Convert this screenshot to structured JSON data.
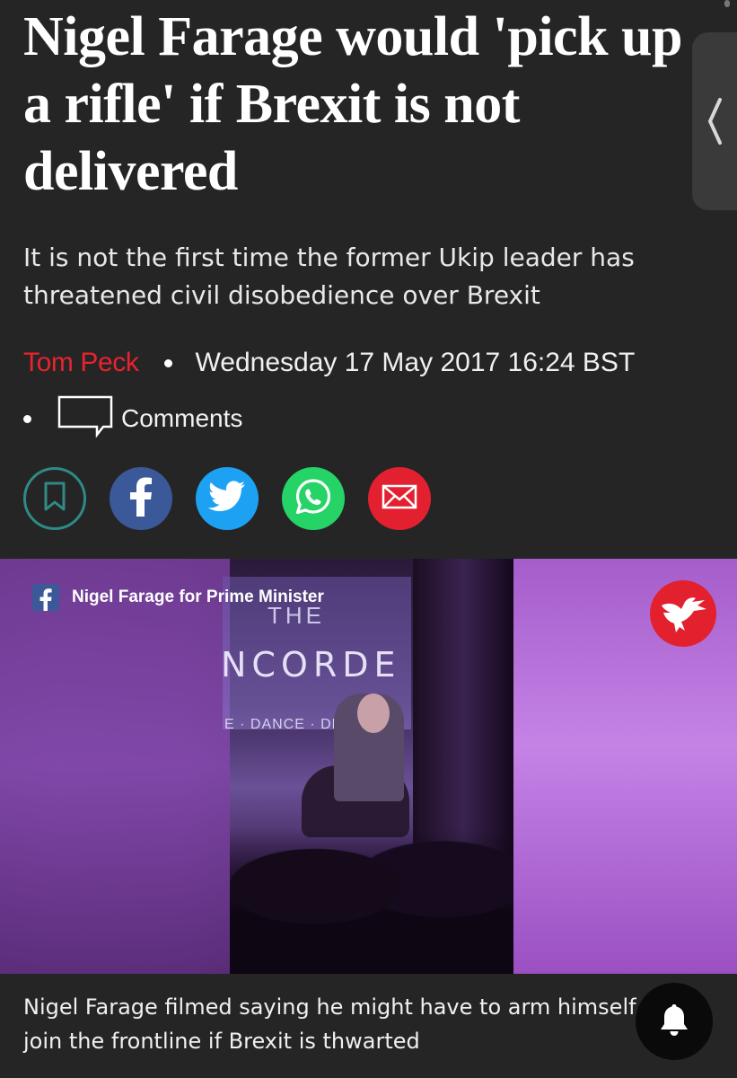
{
  "article": {
    "headline": "Nigel Farage would 'pick up a rifle' if Brexit is not delivered",
    "standfirst": "It is not the first time the former Ukip leader has threatened civil disobedience over Brexit",
    "author": "Tom Peck",
    "date": "Wednesday 17 May 2017 16:24 BST",
    "comments_label": "Comments"
  },
  "share_buttons": [
    {
      "name": "bookmark",
      "icon": "bookmark-icon",
      "color": "#2f8a86"
    },
    {
      "name": "facebook",
      "icon": "facebook-icon",
      "color": "#3b5998"
    },
    {
      "name": "twitter",
      "icon": "twitter-icon",
      "color": "#1da1f2"
    },
    {
      "name": "whatsapp",
      "icon": "whatsapp-icon",
      "color": "#25d366"
    },
    {
      "name": "email",
      "icon": "email-icon",
      "color": "#e3202f"
    }
  ],
  "video": {
    "source_credit": "Nigel Farage for Prime Minister",
    "sign_top": "THE",
    "sign_main": "NCORDE",
    "sign_sub": "E · DANCE · DREAM",
    "logo": "independent-eagle-logo"
  },
  "caption": "Nigel Farage filmed saying he might have to arm himself and join the frontline if Brexit is thwarted",
  "colors": {
    "background": "#252525",
    "author": "#e8232f",
    "accent_teal": "#2f8a86"
  },
  "side_tab": {
    "icon": "chevron-left-icon"
  },
  "notification": {
    "icon": "bell-icon"
  }
}
